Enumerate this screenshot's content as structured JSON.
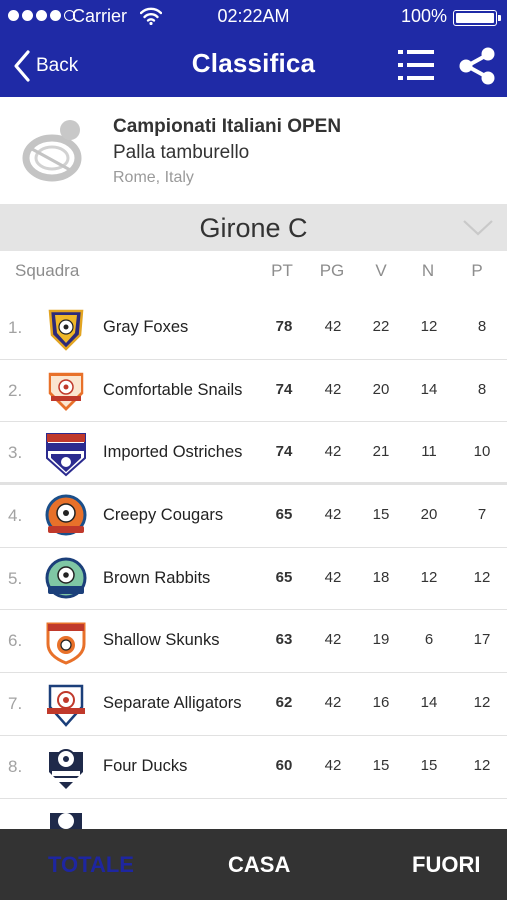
{
  "status_bar": {
    "carrier": "Carrier",
    "time": "02:22AM",
    "battery": "100%"
  },
  "nav": {
    "back_label": "Back",
    "title": "Classifica"
  },
  "championship": {
    "name": "Campionati Italiani OPEN",
    "sport": "Palla tamburello",
    "location": "Rome, Italy"
  },
  "group": {
    "title": "Girone C"
  },
  "columns": {
    "team": "Squadra",
    "pt": "PT",
    "pg": "PG",
    "v": "V",
    "n": "N",
    "p": "P"
  },
  "rows": [
    {
      "rank": "1.",
      "team": "Gray Foxes",
      "pt": "78",
      "pg": "42",
      "v": "22",
      "n": "12",
      "p": "8",
      "crest": "crest-shield-purple-gold"
    },
    {
      "rank": "2.",
      "team": "Comfortable Snails",
      "pt": "74",
      "pg": "42",
      "v": "20",
      "n": "14",
      "p": "8",
      "crest": "crest-shield-orange"
    },
    {
      "rank": "3.",
      "team": "Imported Ostriches",
      "pt": "74",
      "pg": "42",
      "v": "21",
      "n": "11",
      "p": "10",
      "crest": "crest-football-champions"
    },
    {
      "rank": "4.",
      "team": "Creepy Cougars",
      "pt": "65",
      "pg": "42",
      "v": "15",
      "n": "20",
      "p": "7",
      "crest": "crest-fc-united-orange"
    },
    {
      "rank": "5.",
      "team": "Brown Rabbits",
      "pt": "65",
      "pg": "42",
      "v": "18",
      "n": "12",
      "p": "12",
      "crest": "crest-soccer-green"
    },
    {
      "rank": "6.",
      "team": "Shallow Skunks",
      "pt": "63",
      "pg": "42",
      "v": "19",
      "n": "6",
      "p": "17",
      "crest": "crest-shield-red-orange"
    },
    {
      "rank": "7.",
      "team": "Separate Alligators",
      "pt": "62",
      "pg": "42",
      "v": "16",
      "n": "14",
      "p": "12",
      "crest": "crest-fc-united-red"
    },
    {
      "rank": "8.",
      "team": "Four Ducks",
      "pt": "60",
      "pg": "42",
      "v": "15",
      "n": "15",
      "p": "12",
      "crest": "crest-soccer-club-navy"
    }
  ],
  "tabs": {
    "totale": "TOTALE",
    "casa": "CASA",
    "fuori": "FUORI",
    "active": "totale"
  },
  "colors": {
    "brand": "#1f2aa6",
    "tabbar": "#333333",
    "active_tab": "#1e26a0",
    "group_bar": "#e4e4e4"
  }
}
